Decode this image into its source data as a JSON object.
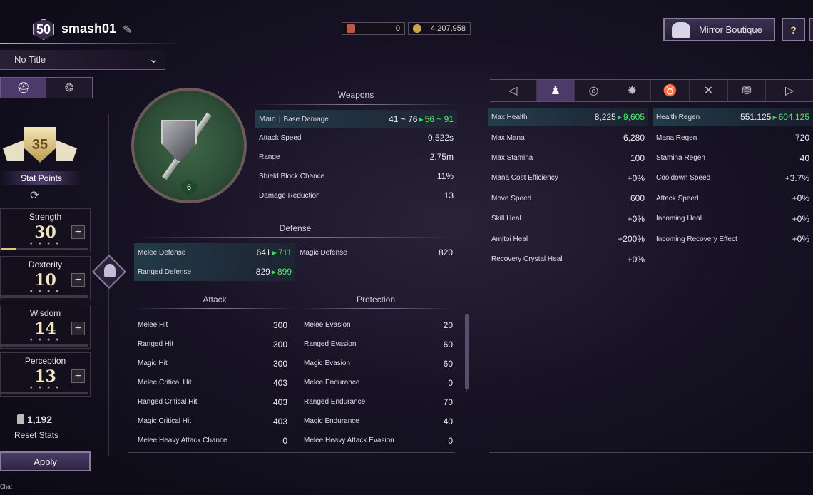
{
  "player": {
    "level": "50",
    "name": "smash01",
    "title": "No Title"
  },
  "currency": [
    {
      "icon": "ticket-icon",
      "value": "0",
      "color": "#c0554a"
    },
    {
      "icon": "gold-coin-icon",
      "value": "4,207,958",
      "color": "#c9a650"
    }
  ],
  "buttons": {
    "boutique": "Mirror Boutique",
    "help": "?",
    "apply": "Apply",
    "reset": "Reset Stats"
  },
  "stat_points": {
    "value": "35",
    "label": "Stat Points"
  },
  "stats": [
    {
      "name": "Strength",
      "value": "30",
      "fill": 0.17
    },
    {
      "name": "Dexterity",
      "value": "10",
      "fill": 0
    },
    {
      "name": "Wisdom",
      "value": "14",
      "fill": 0
    },
    {
      "name": "Perception",
      "value": "13",
      "fill": 0
    }
  ],
  "reset_cost": "1,192",
  "chat_label": "Chat",
  "weapon": {
    "level": "6"
  },
  "weapons": {
    "title": "Weapons",
    "base": {
      "main": "Main",
      "sep": "|",
      "label": "Base Damage",
      "old": "41 ~ 76",
      "new": "56 ~ 91"
    },
    "rows": [
      {
        "label": "Attack Speed",
        "value": "0.522s"
      },
      {
        "label": "Range",
        "value": "2.75m"
      },
      {
        "label": "Shield Block Chance",
        "value": "11%"
      },
      {
        "label": "Damage Reduction",
        "value": "13"
      }
    ]
  },
  "defense": {
    "title": "Defense",
    "melee": {
      "label": "Melee Defense",
      "old": "641",
      "new": "711"
    },
    "ranged": {
      "label": "Ranged Defense",
      "old": "829",
      "new": "899"
    },
    "magic": {
      "label": "Magic Defense",
      "value": "820"
    }
  },
  "attack": {
    "title": "Attack",
    "rows": [
      {
        "label": "Melee Hit",
        "value": "300"
      },
      {
        "label": "Ranged Hit",
        "value": "300"
      },
      {
        "label": "Magic Hit",
        "value": "300"
      },
      {
        "label": "Melee Critical Hit",
        "value": "403"
      },
      {
        "label": "Ranged Critical Hit",
        "value": "403"
      },
      {
        "label": "Magic Critical Hit",
        "value": "403"
      },
      {
        "label": "Melee Heavy Attack Chance",
        "value": "0"
      }
    ]
  },
  "protection": {
    "title": "Protection",
    "rows": [
      {
        "label": "Melee Evasion",
        "value": "20"
      },
      {
        "label": "Ranged Evasion",
        "value": "60"
      },
      {
        "label": "Magic Evasion",
        "value": "60"
      },
      {
        "label": "Melee Endurance",
        "value": "0"
      },
      {
        "label": "Ranged Endurance",
        "value": "70"
      },
      {
        "label": "Magic Endurance",
        "value": "40"
      },
      {
        "label": "Melee Heavy Attack Evasion",
        "value": "0"
      }
    ]
  },
  "right_tabs": [
    "character-icon",
    "vortex-icon",
    "burst-icon",
    "demon-icon",
    "crossed-swords-icon",
    "coins-icon"
  ],
  "general_left": [
    {
      "label": "Max Health",
      "old": "8,225",
      "new": "9,605",
      "hl": true
    },
    {
      "label": "Max Mana",
      "value": "6,280"
    },
    {
      "label": "Max Stamina",
      "value": "100"
    },
    {
      "label": "Mana Cost Efficiency",
      "value": "+0%"
    },
    {
      "label": "Move Speed",
      "value": "600"
    },
    {
      "label": "Skill Heal",
      "value": "+0%"
    },
    {
      "label": "Amitoi Heal",
      "value": "+200%"
    },
    {
      "label": "Recovery Crystal Heal",
      "value": "+0%"
    }
  ],
  "general_right": [
    {
      "label": "Health Regen",
      "old": "551.125",
      "new": "604.125",
      "hl": true
    },
    {
      "label": "Mana Regen",
      "value": "720"
    },
    {
      "label": "Stamina Regen",
      "value": "40"
    },
    {
      "label": "Cooldown Speed",
      "value": "+3.7%"
    },
    {
      "label": "Attack Speed",
      "value": "+0%"
    },
    {
      "label": "Incoming Heal",
      "value": "+0%"
    },
    {
      "label": "Incoming Recovery Effect",
      "value": "+0%"
    }
  ]
}
